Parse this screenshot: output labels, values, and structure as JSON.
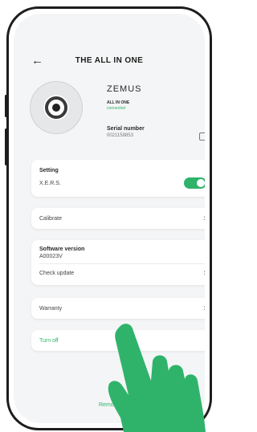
{
  "header": {
    "back_icon": "arrow-left-icon",
    "title": "THE ALL IN ONE"
  },
  "device": {
    "brand": "ZEMUS",
    "model": "ALL IN ONE",
    "status": "connected",
    "serial_label": "Serial number",
    "serial_value": "0021158853",
    "copy_icon": "copy-icon"
  },
  "setting": {
    "title": "Setting",
    "item_label": "X.E.R.S.",
    "toggle_on": true
  },
  "calibrate": {
    "label": "Calibrate"
  },
  "software": {
    "title": "Software version",
    "version": "A00023V",
    "check_label": "Check update"
  },
  "warranty": {
    "label": "Warranty"
  },
  "turn_off": {
    "label": "Turn off"
  },
  "remove": {
    "label": "Remove"
  },
  "colors": {
    "accent": "#2fb36b",
    "background": "#f4f5f6",
    "card": "#ffffff"
  }
}
